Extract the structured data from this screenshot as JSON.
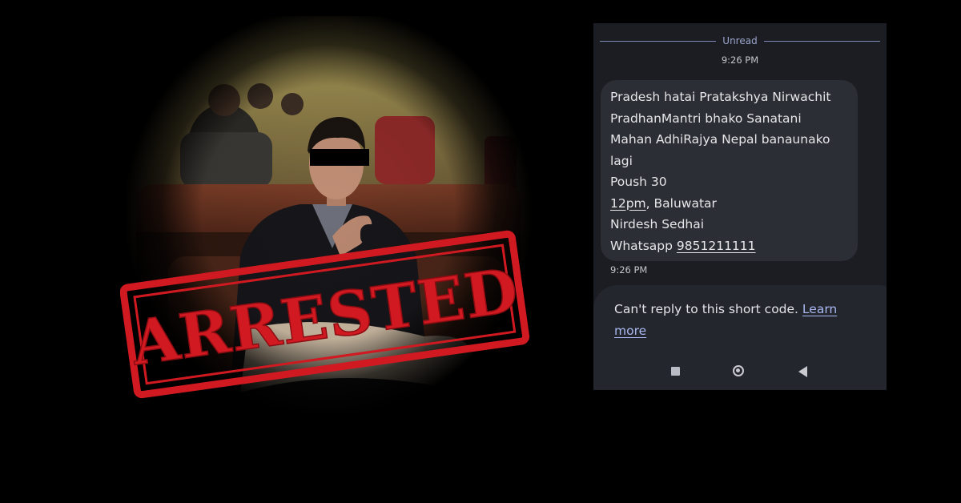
{
  "photo": {
    "stamp_text": "ARRESTED",
    "stamp_color": "#d01920"
  },
  "sms": {
    "unread_label": "Unread",
    "time_top": "9:26 PM",
    "message_lines": [
      "Pradesh hatai Pratakshya Nirwachit",
      "PradhanMantri bhako Sanatani",
      "Mahan AdhiRajya Nepal banaunako",
      "lagi",
      "Poush 30"
    ],
    "time_link": "12pm",
    "place": ", Baluwatar",
    "name": "Nirdesh Sedhai",
    "whatsapp_label": "Whatsapp ",
    "whatsapp_number": "9851211111",
    "time_bottom": "9:26 PM",
    "reply_notice": "Can't reply to this short code. ",
    "learn_more": "Learn more"
  },
  "navbar": {
    "icons": [
      "recents-square-icon",
      "home-circle-icon",
      "back-triangle-icon"
    ]
  }
}
